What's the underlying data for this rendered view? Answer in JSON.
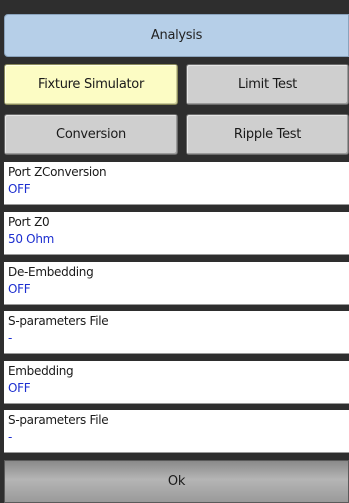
{
  "header": {
    "title": "Analysis"
  },
  "buttons": {
    "fixture_simulator": "Fixture Simulator",
    "limit_test": "Limit Test",
    "conversion": "Conversion",
    "ripple_test": "Ripple Test"
  },
  "fields": [
    {
      "label": "Port ZConversion",
      "value": "OFF"
    },
    {
      "label": "Port Z0",
      "value": "50 Ohm"
    },
    {
      "label": "De-Embedding",
      "value": "OFF"
    },
    {
      "label": "S-parameters File",
      "value": "-"
    },
    {
      "label": "Embedding",
      "value": "OFF"
    },
    {
      "label": "S-parameters File",
      "value": "-"
    }
  ],
  "ok_button": {
    "label": "Ok"
  },
  "colors": {
    "header_bg": "#b6cfe8",
    "active_button_bg": "#fcfcc4",
    "value_text": "#1d2fd0"
  }
}
